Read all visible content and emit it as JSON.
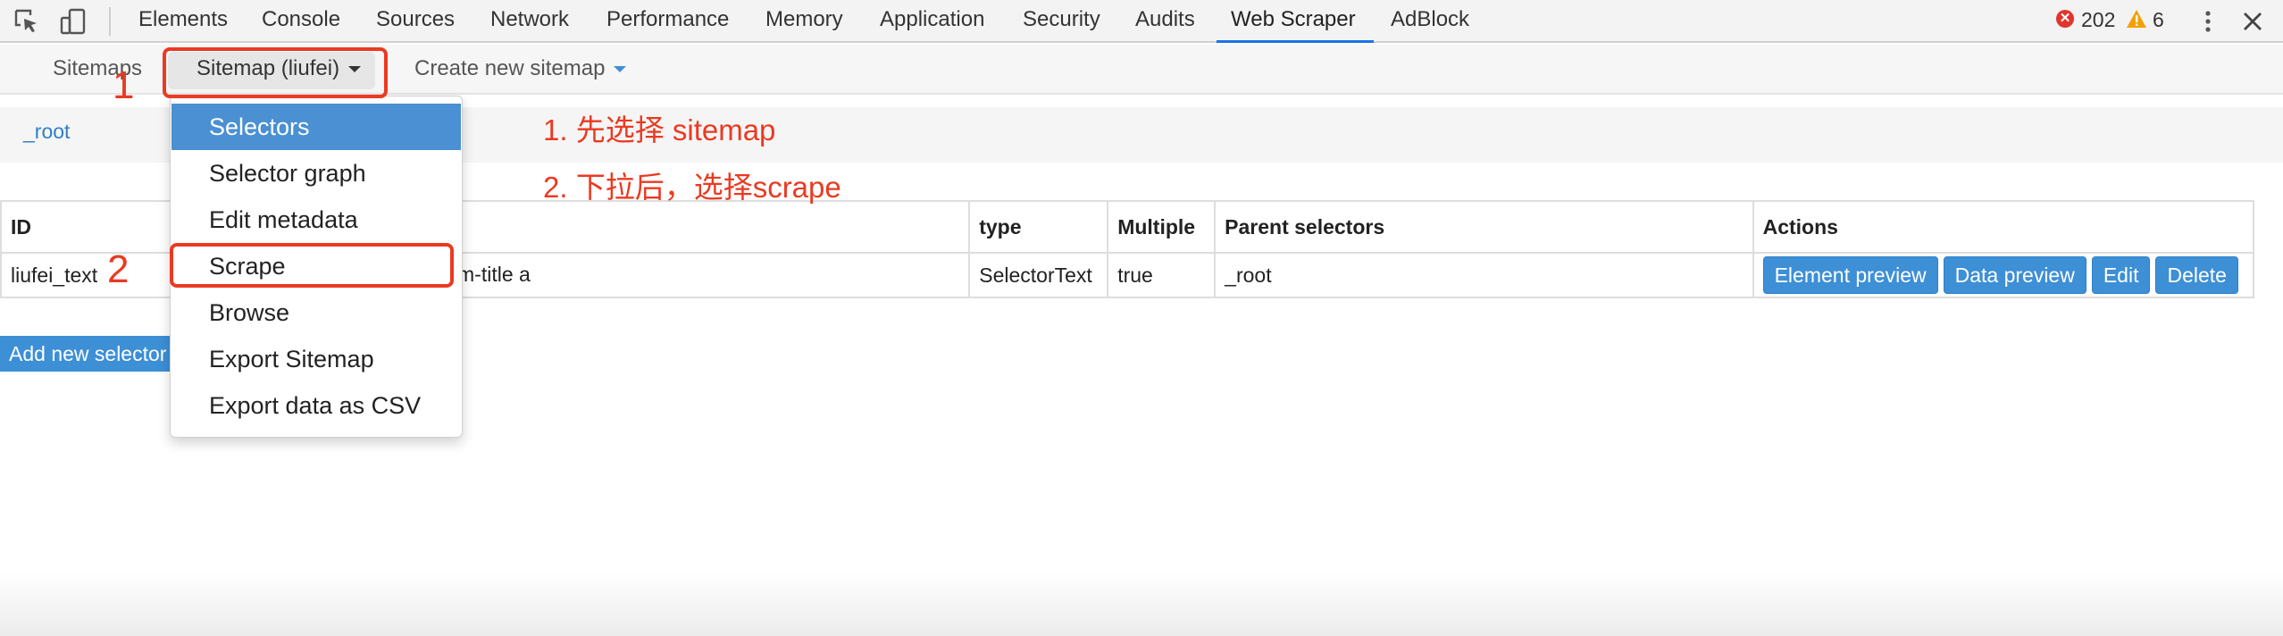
{
  "devtools": {
    "tabs": [
      "Elements",
      "Console",
      "Sources",
      "Network",
      "Performance",
      "Memory",
      "Application",
      "Security",
      "Audits",
      "Web Scraper",
      "AdBlock"
    ],
    "active_tab": "Web Scraper",
    "error_count": "202",
    "warning_count": "6",
    "icons": [
      "inspect-element-icon",
      "device-toggle-icon",
      "error-icon",
      "warning-icon",
      "kebab-menu-icon",
      "close-icon"
    ]
  },
  "nav": {
    "sitemaps_label": "Sitemaps",
    "sitemap_label": "Sitemap (liufei)",
    "create_label": "Create new sitemap"
  },
  "breadcrumb": {
    "root": "_root"
  },
  "table": {
    "headers": [
      "ID",
      "",
      "type",
      "Multiple",
      "Parent selectors",
      "Actions"
    ],
    "rows": [
      {
        "id": "liufei_text",
        "selector": "m-title a",
        "type": "SelectorText",
        "multiple": "true",
        "parent": "_root"
      }
    ],
    "actions": [
      "Element preview",
      "Data preview",
      "Edit",
      "Delete"
    ]
  },
  "add_selector_label": "Add new selector",
  "dropdown": {
    "items": [
      "Selectors",
      "Selector graph",
      "Edit metadata",
      "Scrape",
      "Browse",
      "Export Sitemap",
      "Export data as CSV"
    ],
    "active_item": "Selectors"
  },
  "annotations": {
    "step1_number": "1",
    "step2_number": "2",
    "step1_text": "1. 先选择 sitemap",
    "step2_text": "2. 下拉后，选择scrape"
  },
  "colors": {
    "accent": "#3d8fd6",
    "menu_highlight": "#4a90d2",
    "annotation": "#ea3a22",
    "link": "#2e7fc7",
    "error": "#e0362c",
    "warning": "#f2a100"
  }
}
